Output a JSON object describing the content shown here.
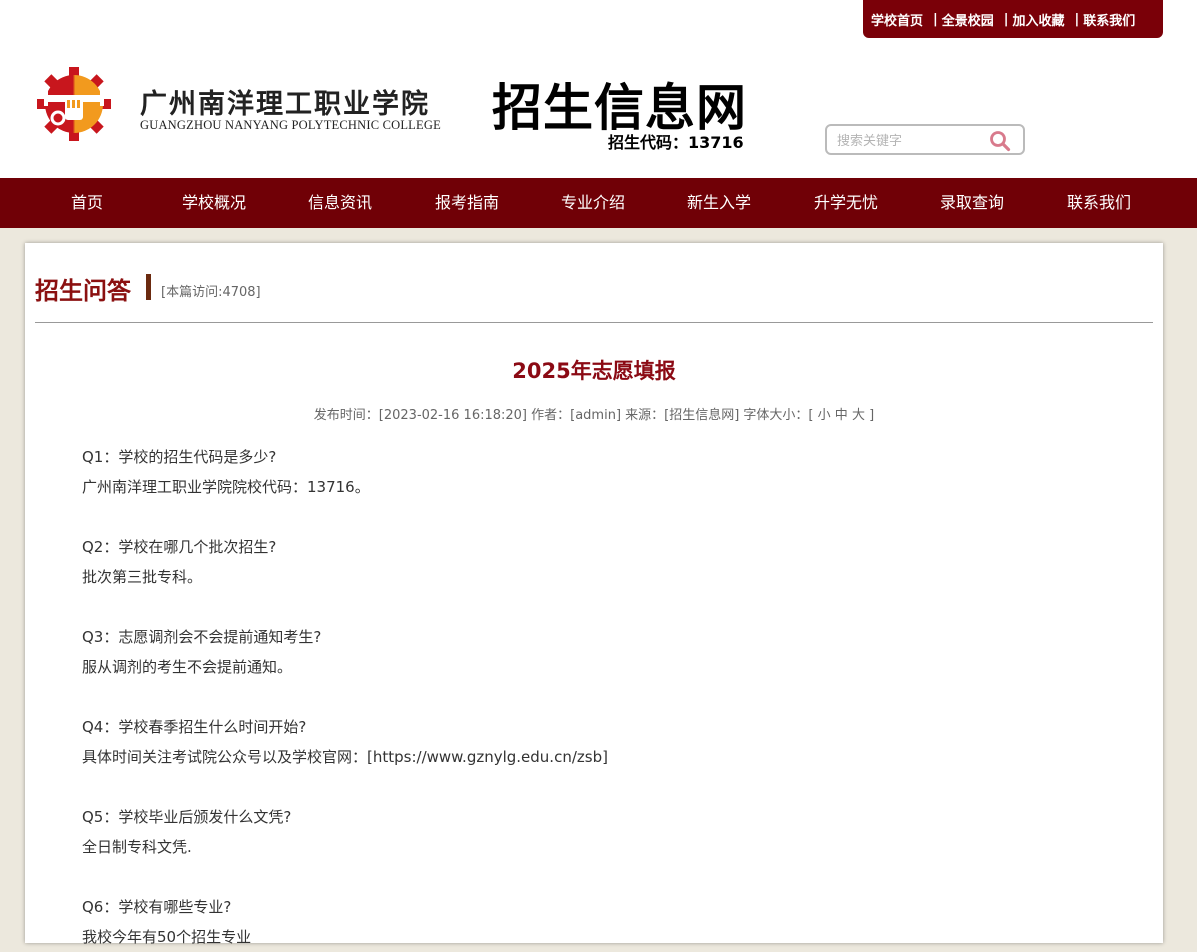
{
  "top_links": [
    "学校首页",
    "全景校园",
    "加入收藏",
    "联系我们"
  ],
  "logo": {
    "name_cn": "广州南洋理工职业学院",
    "name_en": "GUANGZHOU NANYANG POLYTECHNIC COLLEGE"
  },
  "site": {
    "title": "招生信息网",
    "code_line": "招生代码：13716"
  },
  "search": {
    "placeholder": "搜索关键字",
    "icon": "search-icon"
  },
  "nav": [
    "首页",
    "学校概况",
    "信息资讯",
    "报考指南",
    "专业介绍",
    "新生入学",
    "升学无忧",
    "录取查询",
    "联系我们"
  ],
  "section": {
    "title": "招生问答",
    "visits": "[本篇访问:4708]"
  },
  "article": {
    "title": "2025年志愿填报",
    "meta_prefix": "发布时间：[2023-02-16 16:18:20] 作者：[admin] 来源：[招生信息网] 字体大小：[",
    "font_small": "小",
    "font_medium": "中",
    "font_large": "大",
    "meta_suffix": "]",
    "qa": [
      {
        "q": "Q1：学校的招生代码是多少?",
        "a": "广州南洋理工职业学院院校代码：13716。"
      },
      {
        "q": "Q2：学校在哪几个批次招生?",
        "a": "批次第三批专科。"
      },
      {
        "q": "Q3：志愿调剂会不会提前通知考生?",
        "a": "服从调剂的考生不会提前通知。"
      },
      {
        "q": "Q4：学校春季招生什么时间开始?",
        "a": "具体时间关注考试院公众号以及学校官网：[https://www.gznylg.edu.cn/zsb]"
      },
      {
        "q": "Q5：学校毕业后颁发什么文凭?",
        "a": "全日制专科文凭."
      },
      {
        "q": "Q6：学校有哪些专业?",
        "a": "我校今年有50个招生专业"
      }
    ]
  },
  "colors": {
    "brand": "#700006",
    "title_red": "#8b0a14",
    "page_bg": "#ece8dd"
  }
}
